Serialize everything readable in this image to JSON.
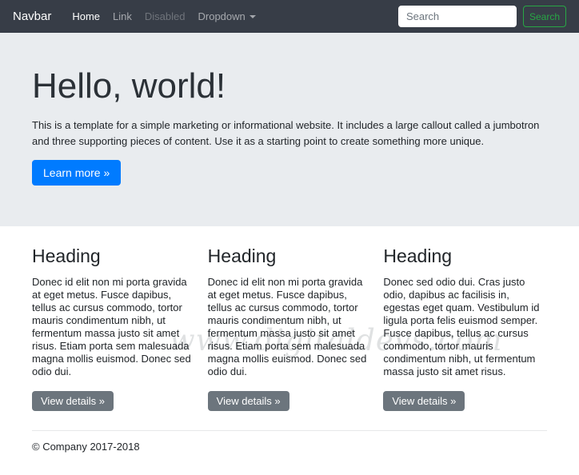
{
  "navbar": {
    "brand": "Navbar",
    "items": [
      {
        "label": "Home",
        "state": "active"
      },
      {
        "label": "Link",
        "state": "default"
      },
      {
        "label": "Disabled",
        "state": "disabled"
      },
      {
        "label": "Dropdown",
        "state": "dropdown"
      }
    ],
    "search": {
      "placeholder": "Search",
      "button_label": "Search"
    }
  },
  "jumbotron": {
    "title": "Hello, world!",
    "description": "This is a template for a simple marketing or informational website. It includes a large callout called a jumbotron and three supporting pieces of content. Use it as a starting point to create something more unique.",
    "cta_label": "Learn more »"
  },
  "columns": [
    {
      "heading": "Heading",
      "body": "Donec id elit non mi porta gravida at eget metus. Fusce dapibus, tellus ac cursus commodo, tortor mauris condimentum nibh, ut fermentum massa justo sit amet risus. Etiam porta sem malesuada magna mollis euismod. Donec sed odio dui.",
      "button_label": "View details »"
    },
    {
      "heading": "Heading",
      "body": "Donec id elit non mi porta gravida at eget metus. Fusce dapibus, tellus ac cursus commodo, tortor mauris condimentum nibh, ut fermentum massa justo sit amet risus. Etiam porta sem malesuada magna mollis euismod. Donec sed odio dui.",
      "button_label": "View details »"
    },
    {
      "heading": "Heading",
      "body": "Donec sed odio dui. Cras justo odio, dapibus ac facilisis in, egestas eget quam. Vestibulum id ligula porta felis euismod semper. Fusce dapibus, tellus ac cursus commodo, tortor mauris condimentum nibh, ut fermentum massa justo sit amet risus.",
      "button_label": "View details »"
    }
  ],
  "footer": {
    "copyright": "© Company 2017-2018"
  },
  "watermark": "www.digitaldevs.com",
  "colors": {
    "navbar_bg": "#373d47",
    "jumbotron_bg": "#e9ecef",
    "primary": "#007bff",
    "secondary": "#6c757d",
    "success": "#28a745"
  }
}
